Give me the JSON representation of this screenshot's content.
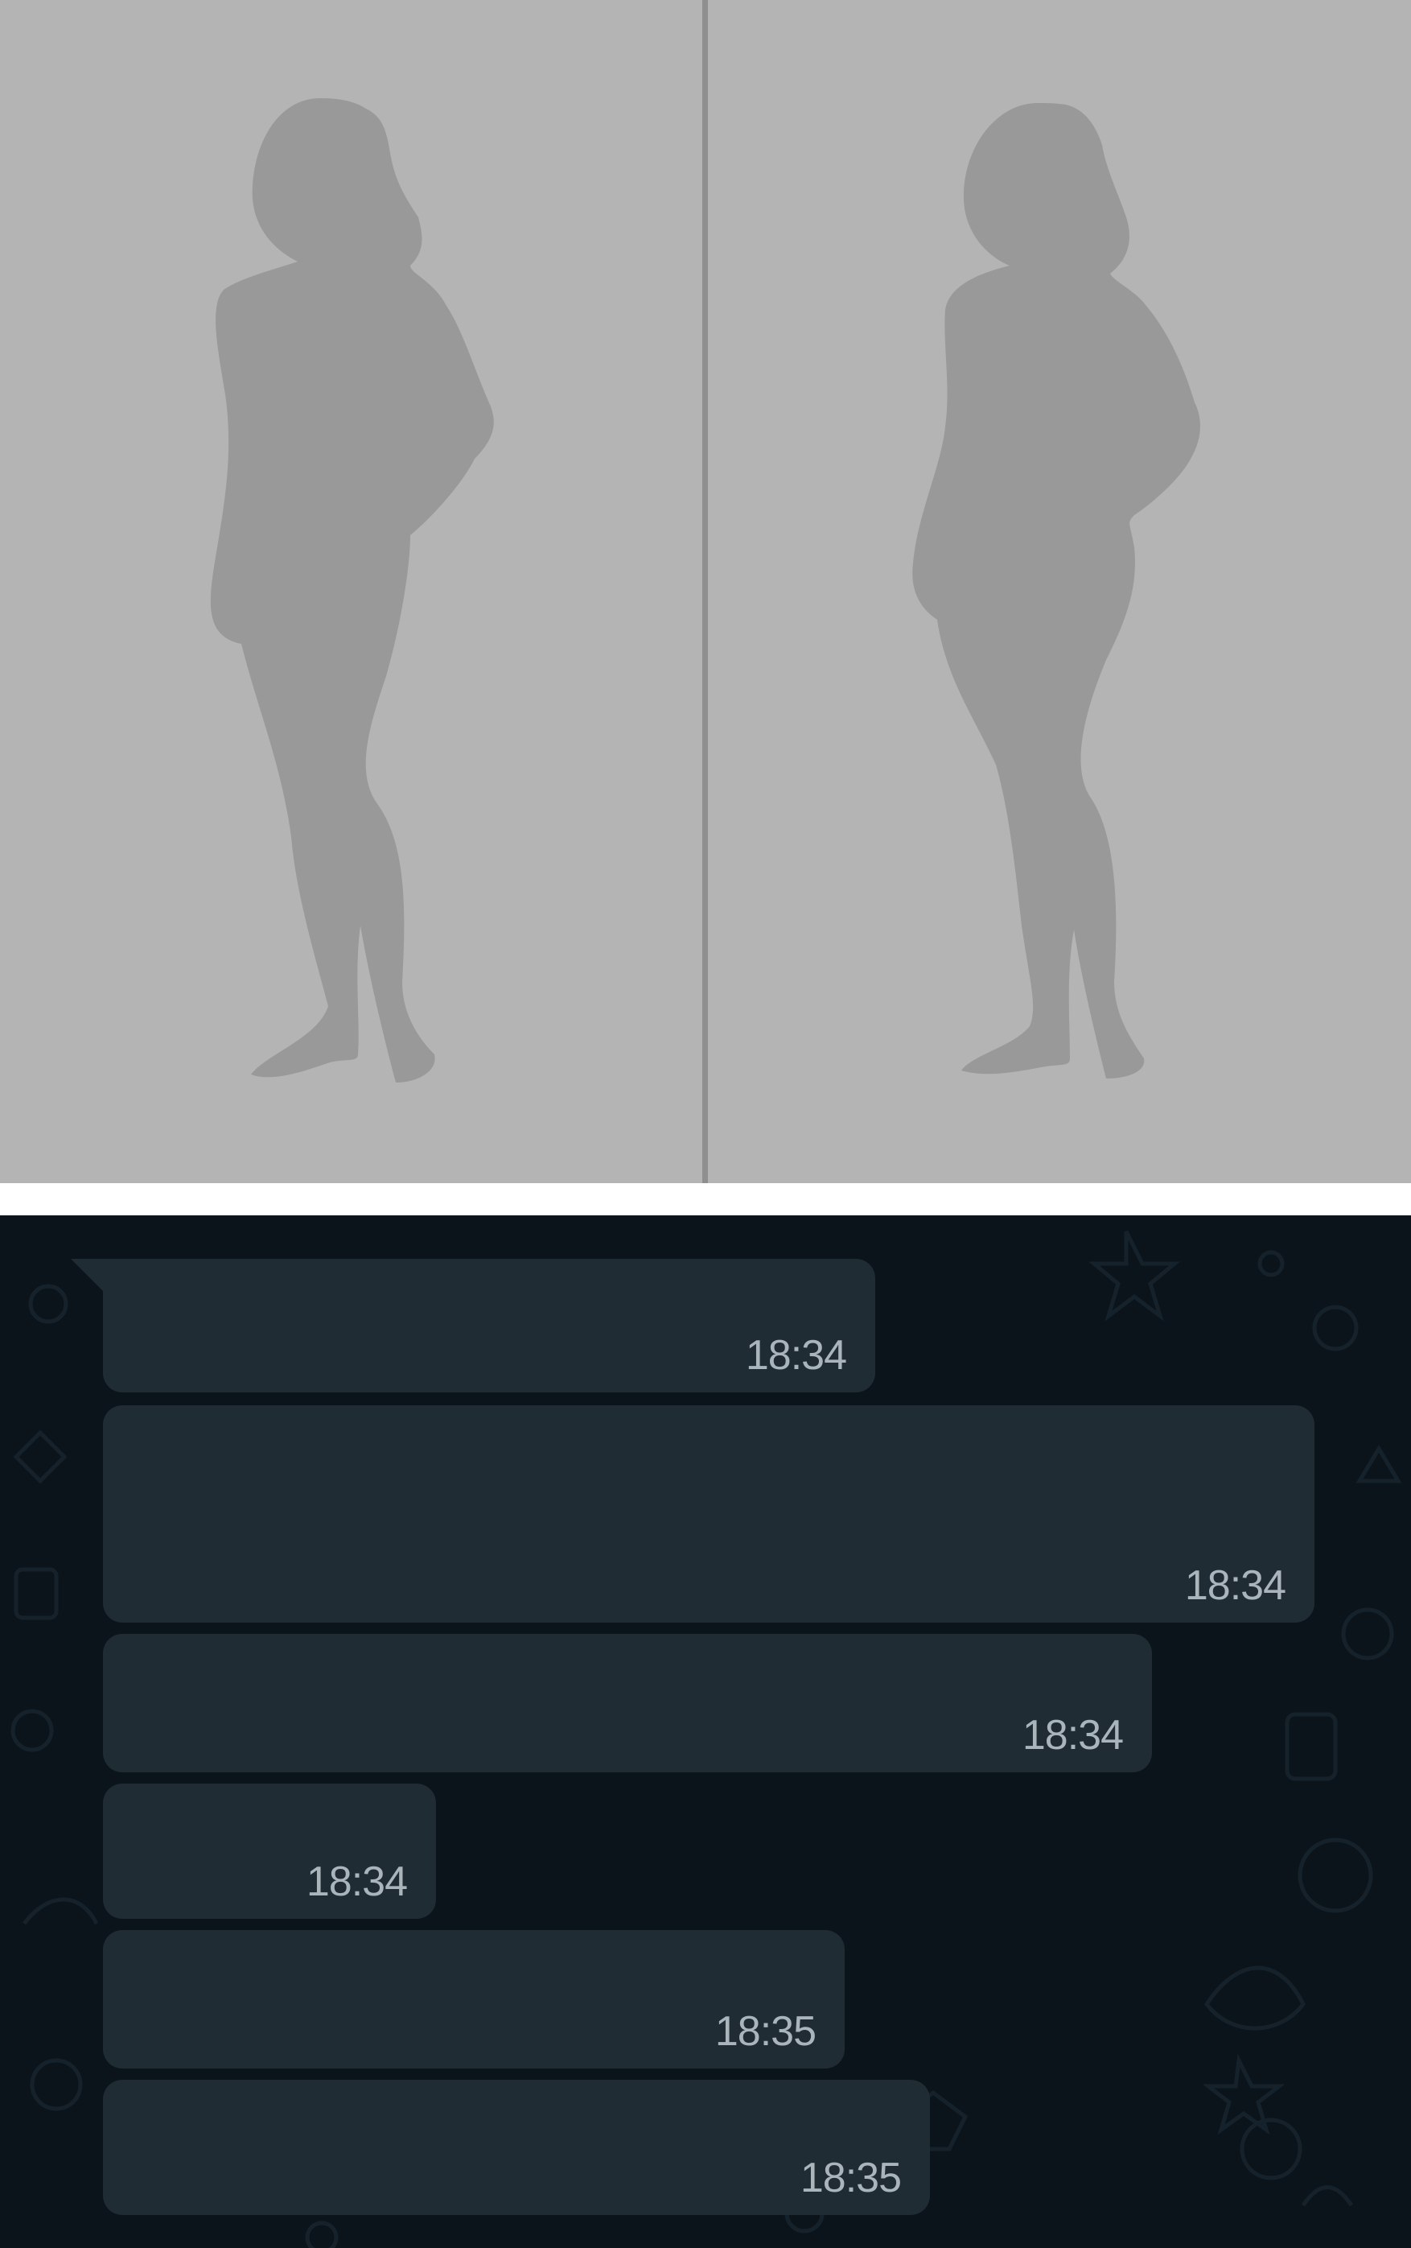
{
  "image": {
    "subject": "silhouette-comparison",
    "colors": {
      "background": "#b4b4b4",
      "silhouette": "#999999",
      "divider": "#8f8f8f"
    }
  },
  "chat": {
    "colors": {
      "background": "#0b141a",
      "bubble": "#1f2c34",
      "timestamp": "#aab4bb",
      "pattern": "#16222b"
    },
    "messages": [
      {
        "time": "18:34"
      },
      {
        "time": "18:34"
      },
      {
        "time": "18:34"
      },
      {
        "time": "18:34"
      },
      {
        "time": "18:35"
      },
      {
        "time": "18:35"
      }
    ]
  }
}
